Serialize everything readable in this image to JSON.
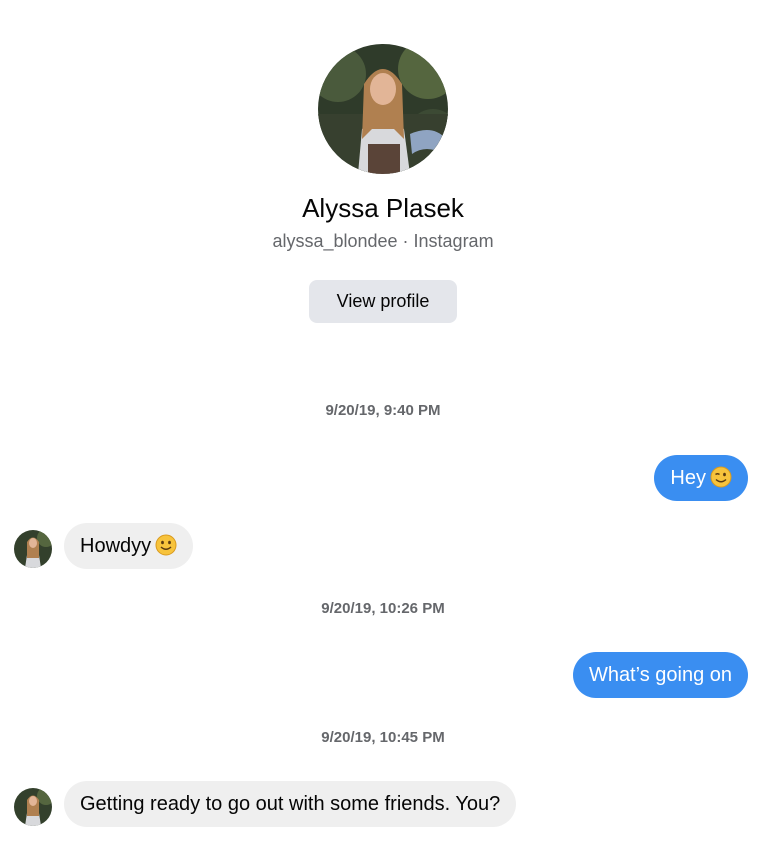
{
  "profile": {
    "name": "Alyssa Plasek",
    "subtitle": "alyssa_blondee · Instagram",
    "view_profile_label": "View profile",
    "avatar_icon": "profile-photo"
  },
  "thread": {
    "timestamps": [
      "9/20/19, 9:40 PM",
      "9/20/19, 10:26 PM",
      "9/20/19, 10:45 PM"
    ],
    "messages": [
      {
        "direction": "outgoing",
        "text": "Hey",
        "emoji": "winking-face-icon"
      },
      {
        "direction": "incoming",
        "text": "Howdyy",
        "emoji": "smiling-face-icon"
      },
      {
        "direction": "outgoing",
        "text": "What’s going on",
        "emoji": ""
      },
      {
        "direction": "incoming",
        "text": "Getting ready to go out with some friends. You?",
        "emoji": ""
      }
    ]
  },
  "colors": {
    "outgoing_bubble": "#3a8ef1",
    "incoming_bubble": "#efefef",
    "secondary_text": "#65676b",
    "button_bg": "#e4e6eb"
  }
}
